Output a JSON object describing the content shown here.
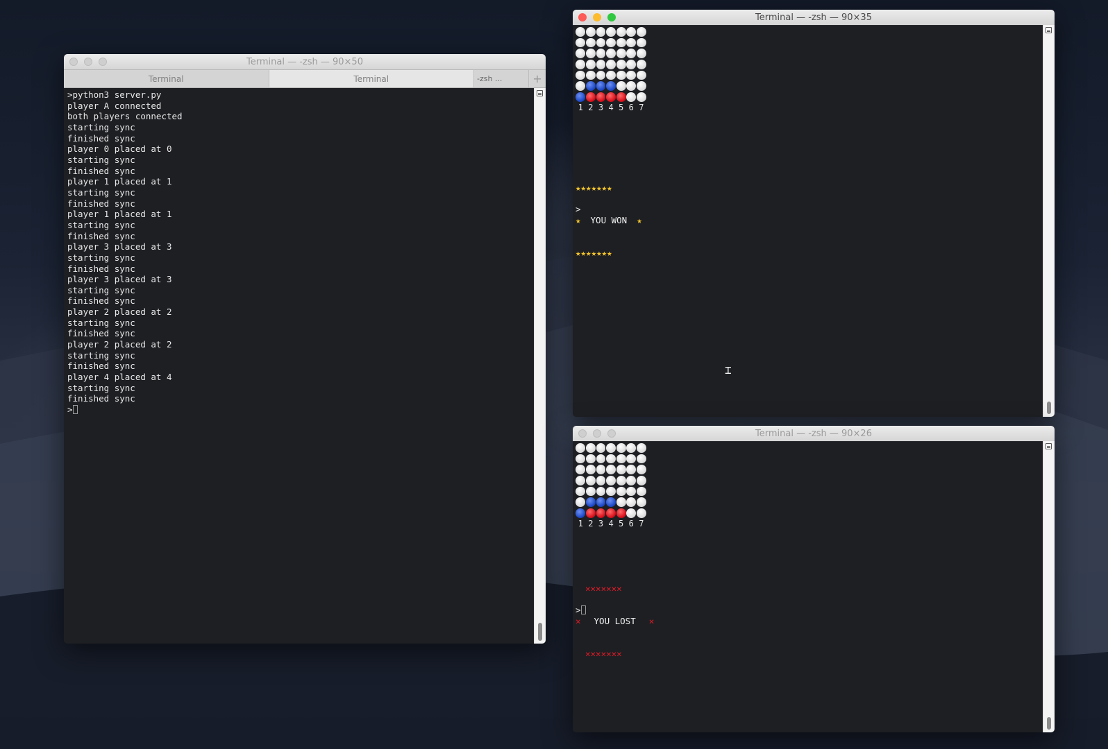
{
  "server_window": {
    "title": "Terminal — -zsh — 90×50",
    "tabs": [
      "Terminal",
      "Terminal",
      "-zsh ..."
    ],
    "new_tab": "+",
    "lines": [
      ">python3 server.py",
      "player A connected",
      "both players connected",
      "starting sync",
      "finished sync",
      "player 0 placed at 0",
      "starting sync",
      "finished sync",
      "player 1 placed at 1",
      "starting sync",
      "finished sync",
      "player 1 placed at 1",
      "starting sync",
      "finished sync",
      "player 3 placed at 3",
      "starting sync",
      "finished sync",
      "player 3 placed at 3",
      "starting sync",
      "finished sync",
      "player 2 placed at 2",
      "starting sync",
      "finished sync",
      "player 2 placed at 2",
      "starting sync",
      "finished sync",
      "player 4 placed at 4",
      "starting sync",
      "finished sync"
    ],
    "prompt": ">"
  },
  "player1_window": {
    "title": "Terminal — -zsh — 90×35",
    "board": [
      [
        "w",
        "w",
        "w",
        "w",
        "w",
        "w",
        "w"
      ],
      [
        "w",
        "w",
        "w",
        "w",
        "w",
        "w",
        "w"
      ],
      [
        "w",
        "w",
        "w",
        "w",
        "w",
        "w",
        "w"
      ],
      [
        "w",
        "w",
        "w",
        "w",
        "w",
        "w",
        "w"
      ],
      [
        "w",
        "w",
        "w",
        "w",
        "w",
        "w",
        "w"
      ],
      [
        "w",
        "b",
        "b",
        "b",
        "w",
        "w",
        "w"
      ],
      [
        "b",
        "r",
        "r",
        "r",
        "r",
        "w",
        "w"
      ]
    ],
    "columns": [
      "1",
      "2",
      "3",
      "4",
      "5",
      "6",
      "7"
    ],
    "result": "YOU WON",
    "prompt": ">"
  },
  "player2_window": {
    "title": "Terminal — -zsh — 90×26",
    "board": [
      [
        "w",
        "w",
        "w",
        "w",
        "w",
        "w",
        "w"
      ],
      [
        "w",
        "w",
        "w",
        "w",
        "w",
        "w",
        "w"
      ],
      [
        "w",
        "w",
        "w",
        "w",
        "w",
        "w",
        "w"
      ],
      [
        "w",
        "w",
        "w",
        "w",
        "w",
        "w",
        "w"
      ],
      [
        "w",
        "w",
        "w",
        "w",
        "w",
        "w",
        "w"
      ],
      [
        "w",
        "b",
        "b",
        "b",
        "w",
        "w",
        "w"
      ],
      [
        "b",
        "r",
        "r",
        "r",
        "r",
        "w",
        "w"
      ]
    ],
    "columns": [
      "1",
      "2",
      "3",
      "4",
      "5",
      "6",
      "7"
    ],
    "result": "YOU LOST",
    "prompt": ">"
  },
  "banner_glyphs": {
    "star": "★",
    "cross": "✕"
  },
  "colors": {
    "disc_white": "#e6e6e6",
    "disc_blue": "#1d49c8",
    "disc_red": "#d8101c",
    "star": "#f5c62c",
    "cross": "#e01b26",
    "terminal_bg": "#1e1f24",
    "close": "#fc5b57",
    "minimize": "#fcbc2e",
    "maximize": "#30c840"
  },
  "icons": [
    "close-icon",
    "minimize-icon",
    "maximize-icon",
    "new-tab-icon",
    "scroll-menu-icon",
    "text-cursor-icon"
  ]
}
